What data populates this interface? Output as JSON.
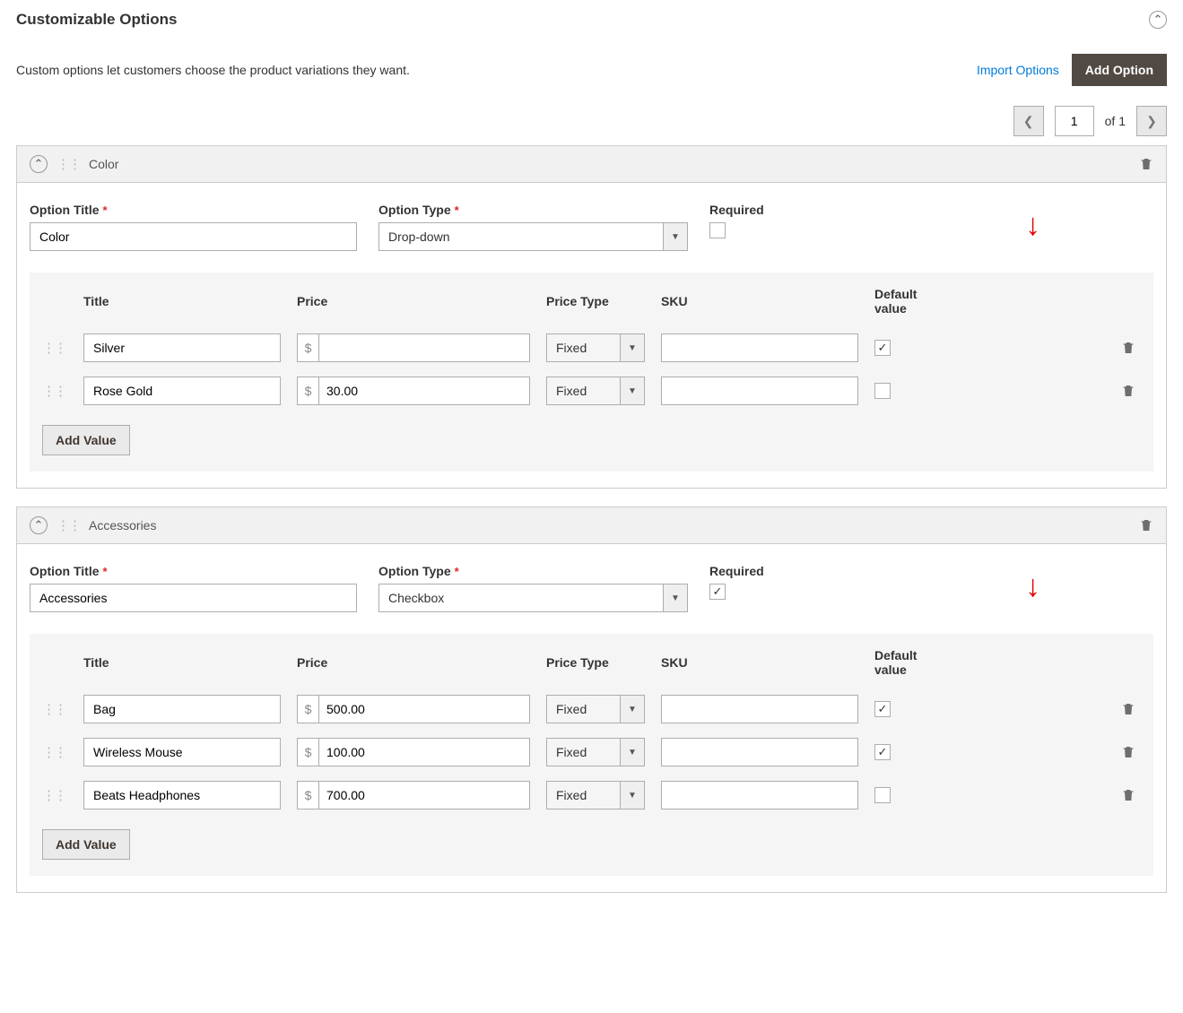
{
  "header": {
    "title": "Customizable Options",
    "description": "Custom options let customers choose the product variations they want.",
    "import_label": "Import Options",
    "add_option_label": "Add Option"
  },
  "pagination": {
    "page": "1",
    "of_label": "of",
    "total": "1"
  },
  "labels": {
    "option_title": "Option Title",
    "option_type": "Option Type",
    "required": "Required",
    "title": "Title",
    "price": "Price",
    "price_type": "Price Type",
    "sku": "SKU",
    "default_value": "Default value",
    "add_value": "Add Value",
    "currency_symbol": "$"
  },
  "options": [
    {
      "name": "Color",
      "title_value": "Color",
      "type_value": "Drop-down",
      "required": false,
      "rows": [
        {
          "title": "Silver",
          "price": "",
          "price_type": "Fixed",
          "sku": "",
          "default": true
        },
        {
          "title": "Rose Gold",
          "price": "30.00",
          "price_type": "Fixed",
          "sku": "",
          "default": false
        }
      ]
    },
    {
      "name": "Accessories",
      "title_value": "Accessories",
      "type_value": "Checkbox",
      "required": true,
      "rows": [
        {
          "title": "Bag",
          "price": "500.00",
          "price_type": "Fixed",
          "sku": "",
          "default": true
        },
        {
          "title": "Wireless Mouse",
          "price": "100.00",
          "price_type": "Fixed",
          "sku": "",
          "default": true
        },
        {
          "title": "Beats Headphones",
          "price": "700.00",
          "price_type": "Fixed",
          "sku": "",
          "default": false
        }
      ]
    }
  ]
}
